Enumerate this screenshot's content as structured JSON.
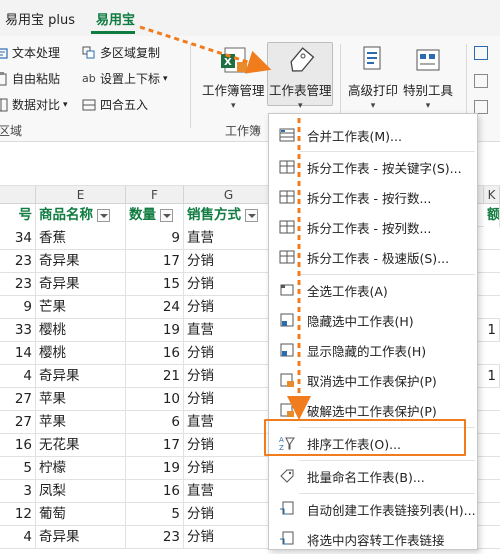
{
  "tabs": [
    {
      "label": "易用宝 plus"
    },
    {
      "label": "易用宝"
    }
  ],
  "ribbon": {
    "left_items": [
      {
        "label": "文本处理"
      },
      {
        "label": "多区域复制"
      },
      {
        "label": "自由粘贴"
      },
      {
        "label": "设置上下标"
      },
      {
        "label": "数据对比"
      },
      {
        "label": "四合五入"
      }
    ],
    "left_group_label": "区域",
    "big_buttons": [
      {
        "label": "工作簿管理"
      },
      {
        "label": "工作表管理"
      },
      {
        "label": "高级打印"
      },
      {
        "label": "特别工具"
      }
    ],
    "group_label_mid": "工作簿",
    "caret": "▾"
  },
  "columns": [
    {
      "letter": "E"
    },
    {
      "letter": "F"
    },
    {
      "letter": "G"
    },
    {
      "letter": "K"
    }
  ],
  "table": {
    "headers": [
      "号",
      "商品名称",
      "数量",
      "销售方式",
      "额"
    ],
    "rows": [
      {
        "id": "34",
        "name": "香蕉",
        "qty": "9",
        "mode": "直营"
      },
      {
        "id": "23",
        "name": "奇异果",
        "qty": "17",
        "mode": "分销"
      },
      {
        "id": "23",
        "name": "奇异果",
        "qty": "15",
        "mode": "分销"
      },
      {
        "id": "9",
        "name": "芒果",
        "qty": "24",
        "mode": "分销"
      },
      {
        "id": "33",
        "name": "樱桃",
        "qty": "19",
        "mode": "直营"
      },
      {
        "id": "14",
        "name": "樱桃",
        "qty": "16",
        "mode": "分销"
      },
      {
        "id": "4",
        "name": "奇异果",
        "qty": "21",
        "mode": "分销"
      },
      {
        "id": "27",
        "name": "苹果",
        "qty": "10",
        "mode": "分销"
      },
      {
        "id": "27",
        "name": "苹果",
        "qty": "6",
        "mode": "直营"
      },
      {
        "id": "16",
        "name": "无花果",
        "qty": "17",
        "mode": "分销"
      },
      {
        "id": "5",
        "name": "柠檬",
        "qty": "19",
        "mode": "分销"
      },
      {
        "id": "3",
        "name": "凤梨",
        "qty": "16",
        "mode": "直营"
      },
      {
        "id": "12",
        "name": "葡萄",
        "qty": "5",
        "mode": "分销"
      },
      {
        "id": "4",
        "name": "奇异果",
        "qty": "23",
        "mode": "分销"
      }
    ],
    "right_col_values": [
      "1",
      "1"
    ]
  },
  "menu": {
    "items": [
      {
        "label": "合并工作表(M)..."
      },
      {
        "label": "拆分工作表 - 按关键字(S)..."
      },
      {
        "label": "拆分工作表 - 按行数..."
      },
      {
        "label": "拆分工作表 - 按列数..."
      },
      {
        "label": "拆分工作表 - 极速版(S)..."
      },
      {
        "label": "全选工作表(A)"
      },
      {
        "label": "隐藏选中工作表(H)"
      },
      {
        "label": "显示隐藏的工作表(H)"
      },
      {
        "label": "取消选中工作表保护(P)"
      },
      {
        "label": "破解选中工作表保护(P)"
      },
      {
        "label": "排序工作表(O)..."
      },
      {
        "label": "批量命名工作表(B)..."
      },
      {
        "label": "自动创建工作表链接列表(H)..."
      },
      {
        "label": "将选中内容转工作表链接"
      }
    ]
  },
  "colors": {
    "accent_green": "#107c41",
    "highlight_orange": "#f07c1d"
  }
}
